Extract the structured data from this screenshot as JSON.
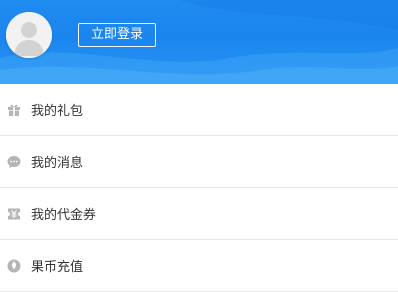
{
  "header": {
    "login_label": "立即登录",
    "background_color": "#1f8cf0"
  },
  "menu": {
    "items": [
      {
        "label": "我的礼包",
        "icon": "gift-icon"
      },
      {
        "label": "我的消息",
        "icon": "message-icon"
      },
      {
        "label": "我的代金券",
        "icon": "voucher-icon"
      },
      {
        "label": "果币充值",
        "icon": "coin-icon"
      }
    ],
    "icon_color": "#b5b5b5",
    "text_color": "#333333",
    "divider_color": "#e6e6e6"
  }
}
